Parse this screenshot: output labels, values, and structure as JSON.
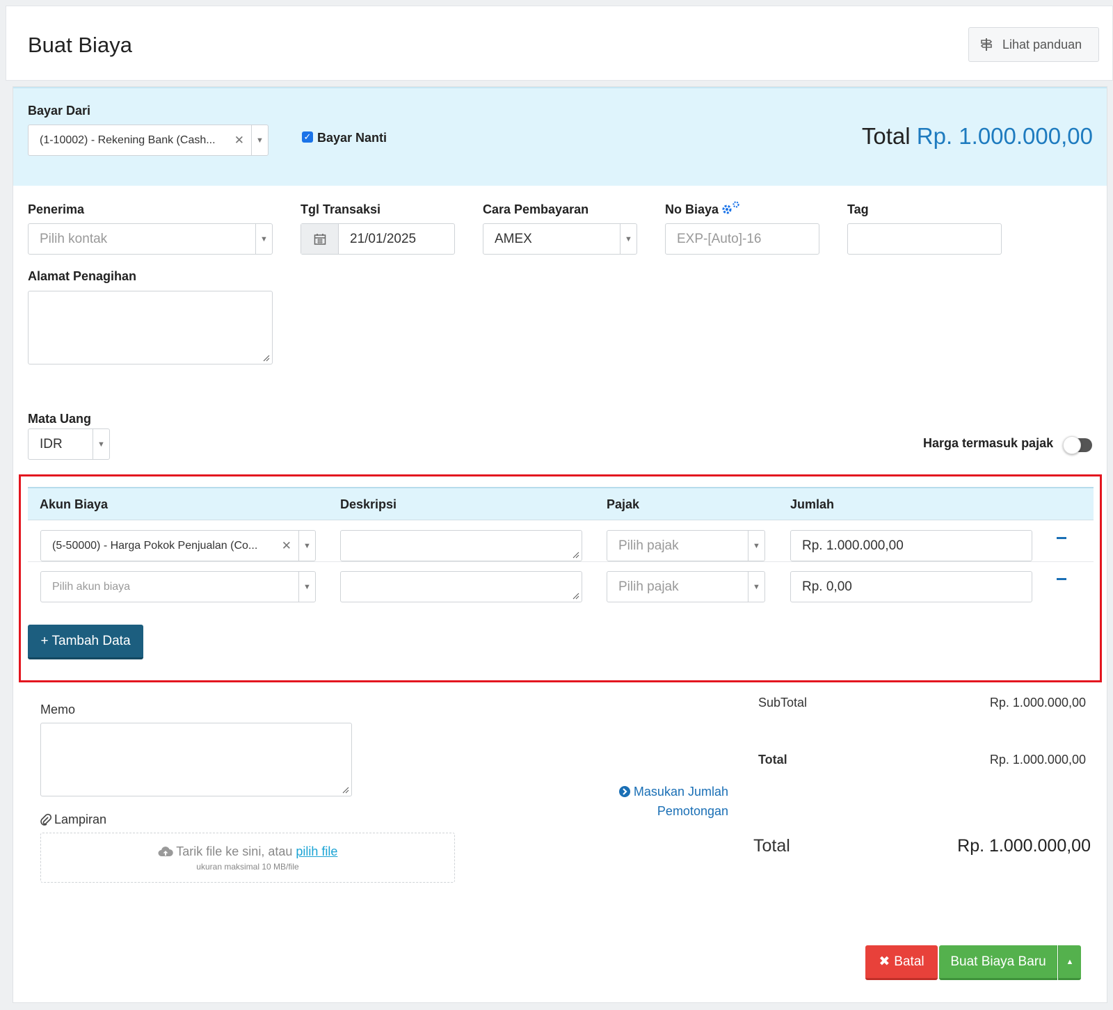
{
  "header": {
    "title": "Buat Biaya",
    "guide_label": "Lihat panduan",
    "guide_icon": "signpost-icon"
  },
  "bayar_dari": {
    "label": "Bayar Dari",
    "value": "(1-10002) - Rekening Bank (Cash...",
    "pay_later_label": "Bayar Nanti",
    "pay_later_checked": true
  },
  "total_top": {
    "label": "Total",
    "amount": "Rp. 1.000.000,00"
  },
  "penerima": {
    "label": "Penerima",
    "placeholder": "Pilih kontak"
  },
  "tgl_transaksi": {
    "label": "Tgl Transaksi",
    "value": "21/01/2025"
  },
  "cara_pembayaran": {
    "label": "Cara Pembayaran",
    "value": "AMEX"
  },
  "no_biaya": {
    "label": "No Biaya",
    "placeholder": "EXP-[Auto]-16"
  },
  "tag": {
    "label": "Tag",
    "value": ""
  },
  "alamat": {
    "label": "Alamat Penagihan"
  },
  "mata_uang": {
    "label": "Mata Uang",
    "value": "IDR"
  },
  "harga_pajak": {
    "label": "Harga termasuk pajak",
    "enabled": false
  },
  "table": {
    "headers": {
      "akun": "Akun Biaya",
      "deskripsi": "Deskripsi",
      "pajak": "Pajak",
      "jumlah": "Jumlah"
    },
    "rows": [
      {
        "akun": "(5-50000) - Harga Pokok Penjualan (Co...",
        "akun_is_placeholder": false,
        "pajak_placeholder": "Pilih pajak",
        "jumlah": "Rp. 1.000.000,00"
      },
      {
        "akun": "Pilih akun biaya",
        "akun_is_placeholder": true,
        "pajak_placeholder": "Pilih pajak",
        "jumlah": "Rp. 0,00"
      }
    ],
    "add_label": "+ Tambah Data"
  },
  "memo": {
    "label": "Memo"
  },
  "lampiran": {
    "label": "Lampiran",
    "drop_text": "Tarik file ke sini, atau ",
    "drop_link": "pilih file",
    "size_note": "ukuran maksimal 10 MB/file"
  },
  "summary": {
    "subtotal_label": "SubTotal",
    "subtotal": "Rp. 1.000.000,00",
    "total_label": "Total",
    "total": "Rp. 1.000.000,00",
    "potongan_line1": "Masukan Jumlah",
    "potongan_line2": "Pemotongan",
    "grand_label": "Total",
    "grand": "Rp. 1.000.000,00"
  },
  "actions": {
    "cancel_label": "Batal",
    "create_label": "Buat Biaya Baru"
  },
  "colors": {
    "accent": "#1e7bbf",
    "highlight_box": "#e3161f",
    "add_button": "#1c5e7f",
    "cancel": "#e8413a",
    "create": "#54b14d"
  }
}
